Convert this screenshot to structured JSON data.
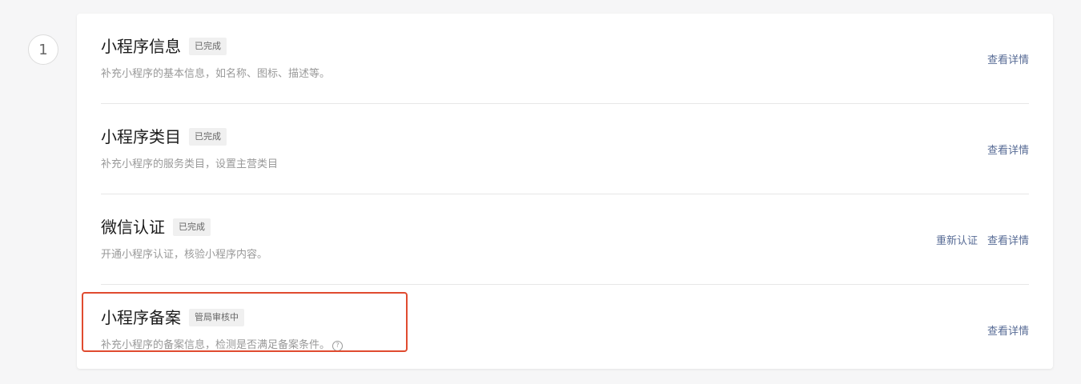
{
  "step": {
    "number": "1"
  },
  "rows": [
    {
      "title": "小程序信息",
      "badge": "已完成",
      "description": "补充小程序的基本信息，如名称、图标、描述等。",
      "actions": [
        "查看详情"
      ]
    },
    {
      "title": "小程序类目",
      "badge": "已完成",
      "description": "补充小程序的服务类目，设置主营类目",
      "actions": [
        "查看详情"
      ]
    },
    {
      "title": "微信认证",
      "badge": "已完成",
      "description": "开通小程序认证，核验小程序内容。",
      "actions": [
        "重新认证",
        "查看详情"
      ]
    },
    {
      "title": "小程序备案",
      "badge": "管局审核中",
      "description": "补充小程序的备案信息，检测是否满足备案条件。",
      "help_icon": "?",
      "actions": [
        "查看详情"
      ]
    }
  ],
  "colors": {
    "link": "#576b95",
    "highlight": "#e04b2f",
    "badge_bg": "#f0f0f0"
  },
  "icons": {
    "help": "question-circle-icon"
  }
}
